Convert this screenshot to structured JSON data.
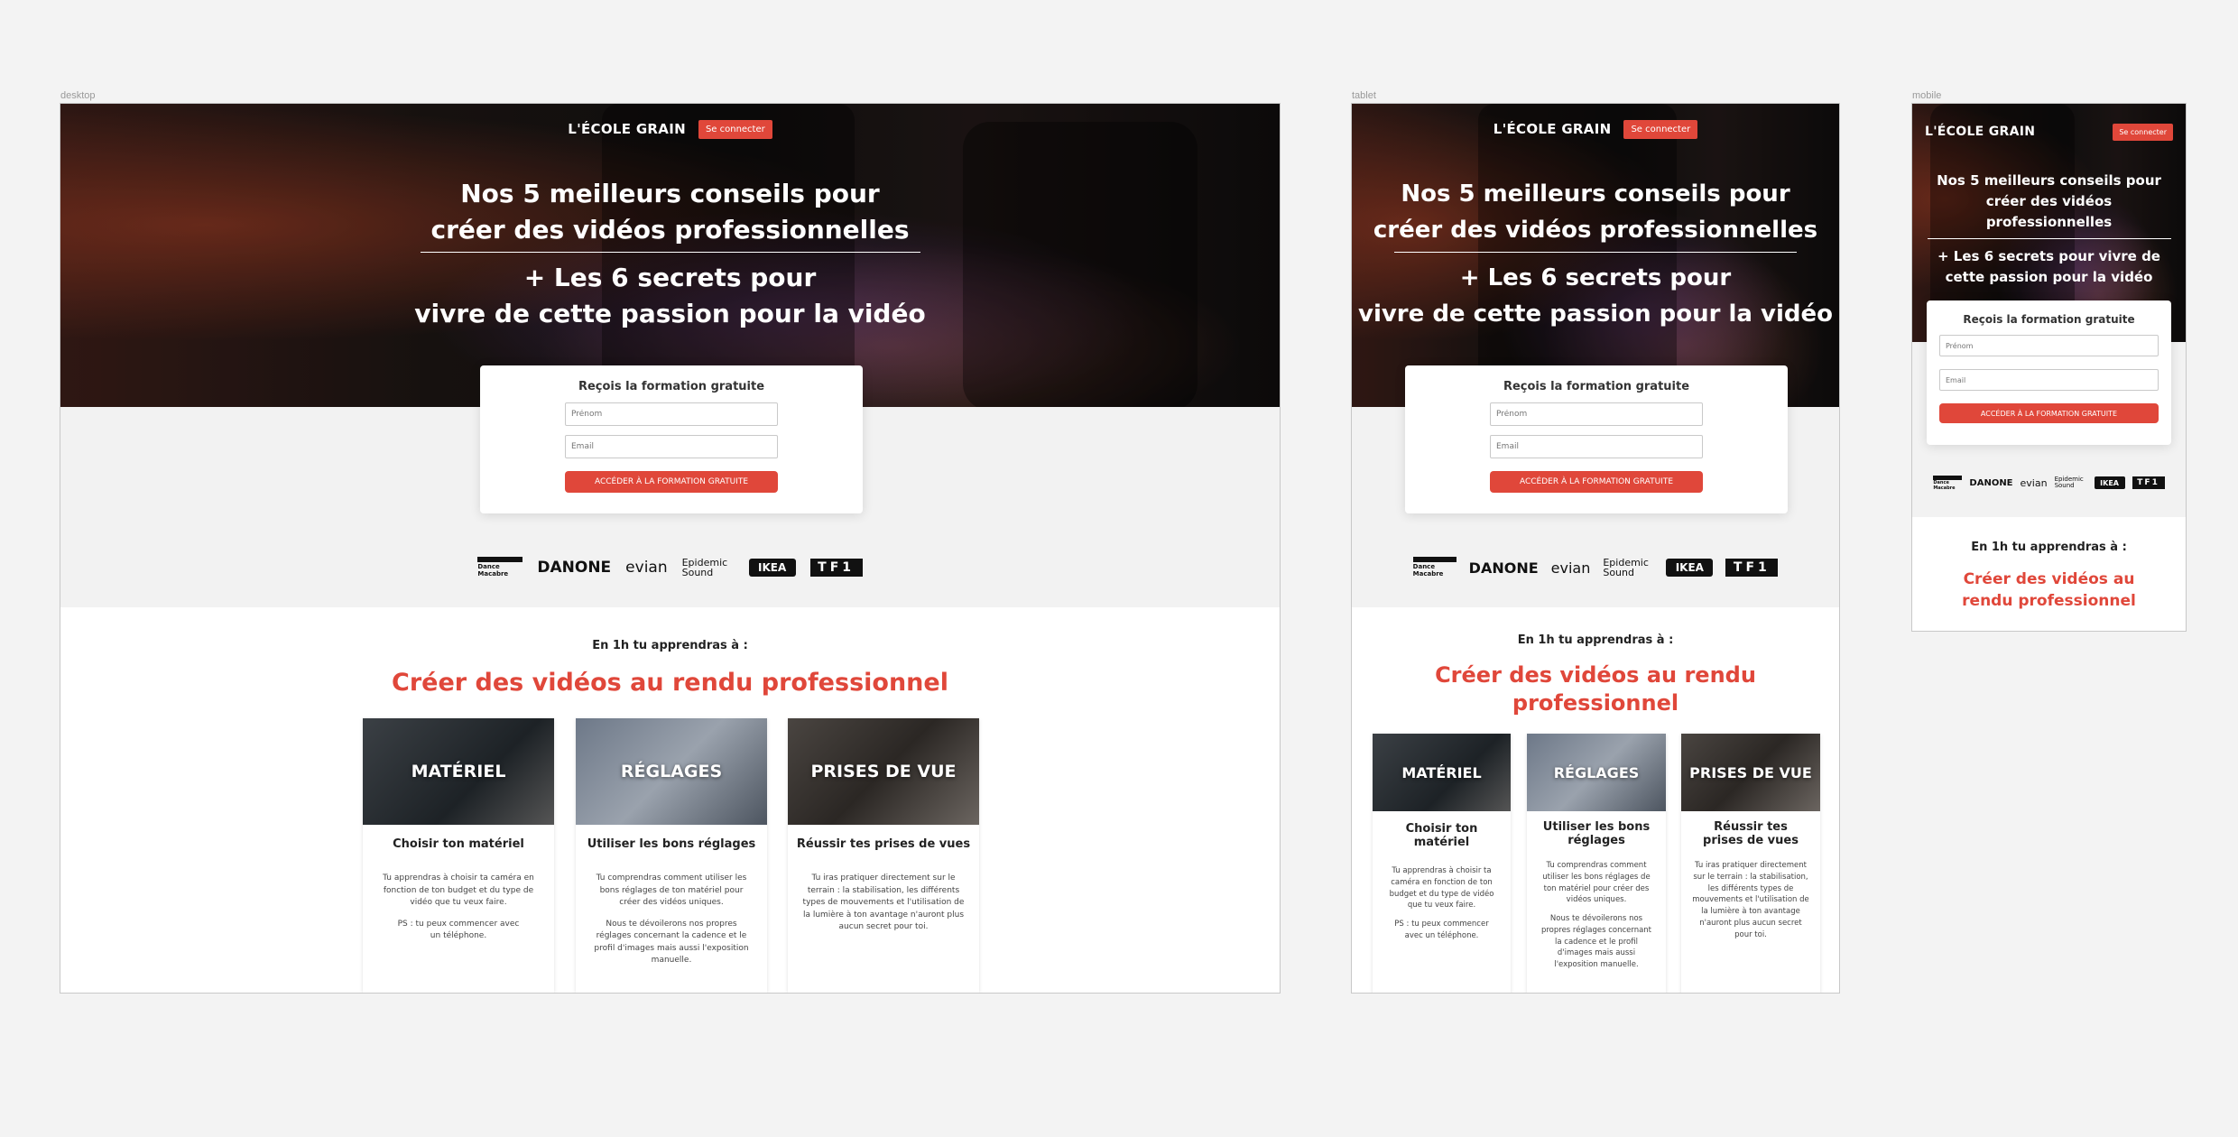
{
  "frames": {
    "desktop": "desktop",
    "tablet": "tablet",
    "mobile": "mobile"
  },
  "brand": "L'ÉCOLE GRAIN",
  "login_label": "Se connecter",
  "hero": {
    "line1": "Nos 5 meilleurs conseils pour",
    "line2": "créer des vidéos professionnelles",
    "line3": "+ Les 6 secrets pour",
    "line4": "vivre de cette passion pour la vidéo",
    "mobile_a": "Nos 5 meilleurs conseils pour créer des vidéos professionnelles",
    "mobile_b": "+ Les 6 secrets pour vivre de cette passion pour la vidéo"
  },
  "form": {
    "title": "Reçois la formation gratuite",
    "firstname_placeholder": "Prénom",
    "email_placeholder": "Email",
    "cta": "ACCÉDER À LA FORMATION GRATUITE"
  },
  "logos": [
    "Dance Macabre",
    "DANONE",
    "evian",
    "Epidemic Sound",
    "IKEA",
    "TF1"
  ],
  "learn": {
    "kicker": "En 1h tu apprendras à :",
    "headline": "Créer des vidéos au rendu professionnel"
  },
  "cards": [
    {
      "tag": "MATÉRIEL",
      "title": "Choisir ton matériel",
      "p1": "Tu apprendras à choisir ta caméra en fonction de ton budget et du type de vidéo que tu veux faire.",
      "p2": "PS : tu peux commencer avec un téléphone."
    },
    {
      "tag": "RÉGLAGES",
      "title": "Utiliser les bons réglages",
      "p1": "Tu comprendras comment utiliser les bons réglages de ton matériel pour créer des vidéos uniques.",
      "p2": "Nous te dévoilerons nos propres réglages concernant la cadence et le profil d'images mais aussi l'exposition manuelle."
    },
    {
      "tag": "PRISES DE VUE",
      "title": "Réussir tes prises de vues",
      "p1": "Tu iras pratiquer directement sur le terrain : la stabilisation, les différents types de mouvements et l'utilisation de la lumière à ton avantage n'auront plus aucun secret pour toi.",
      "p2": ""
    }
  ],
  "colors": {
    "accent": "#e0473a"
  }
}
